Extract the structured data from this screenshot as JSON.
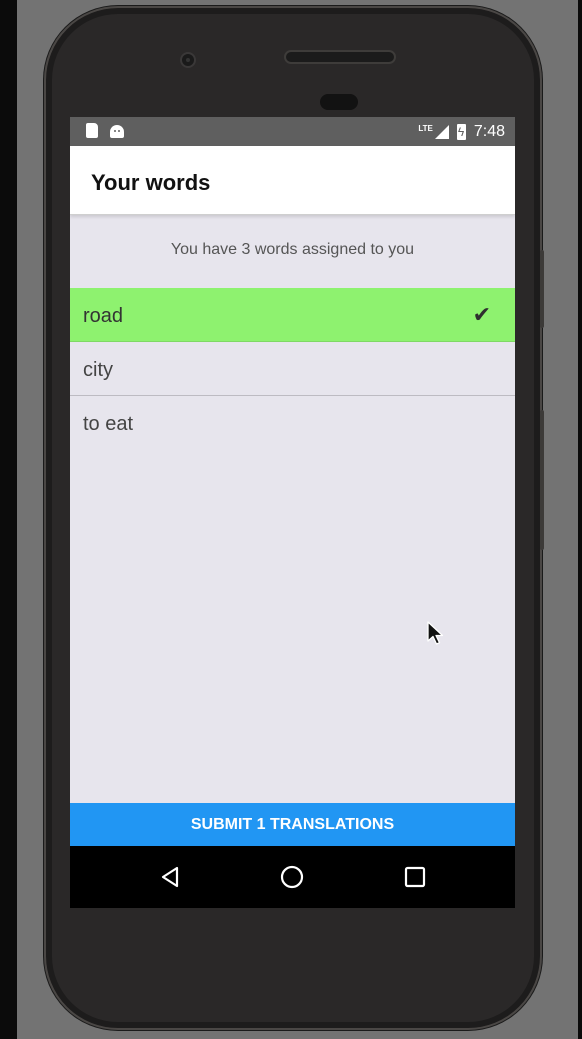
{
  "status_bar": {
    "network_label": "LTE",
    "time": "7:48",
    "icons": [
      "sd-card-icon",
      "android-icon",
      "signal-icon",
      "battery-charging-icon"
    ]
  },
  "app_bar": {
    "title": "Your words"
  },
  "main": {
    "summary": "You have 3 words assigned to you",
    "words": [
      {
        "text": "road",
        "translated": true
      },
      {
        "text": "city",
        "translated": false
      },
      {
        "text": "to eat",
        "translated": false
      }
    ],
    "check_symbol": "✔"
  },
  "submit_label": "SUBMIT 1 TRANSLATIONS",
  "nav_bar": {
    "buttons": [
      "back-icon",
      "home-icon",
      "recents-icon"
    ]
  },
  "colors": {
    "selected_row": "#8ef26f",
    "submit_button": "#2196f3",
    "status_bar": "#5f5f5f",
    "background": "#e7e5ed"
  }
}
